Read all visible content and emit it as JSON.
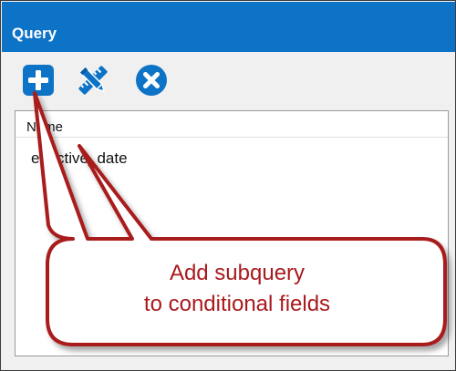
{
  "panel": {
    "title": "Query",
    "accent_color": "#0c73c6"
  },
  "toolbar": {
    "buttons": [
      {
        "name": "add-subquery-button",
        "icon": "plus-square-icon"
      },
      {
        "name": "edit-button",
        "icon": "pencil-ruler-icon"
      },
      {
        "name": "remove-button",
        "icon": "x-circle-icon"
      }
    ]
  },
  "list": {
    "column_header": "Name",
    "rows": [
      {
        "name": "effective_date"
      }
    ]
  },
  "callout": {
    "line1": "Add subquery",
    "line2": "to conditional fields",
    "border_color": "#a91a1d"
  }
}
